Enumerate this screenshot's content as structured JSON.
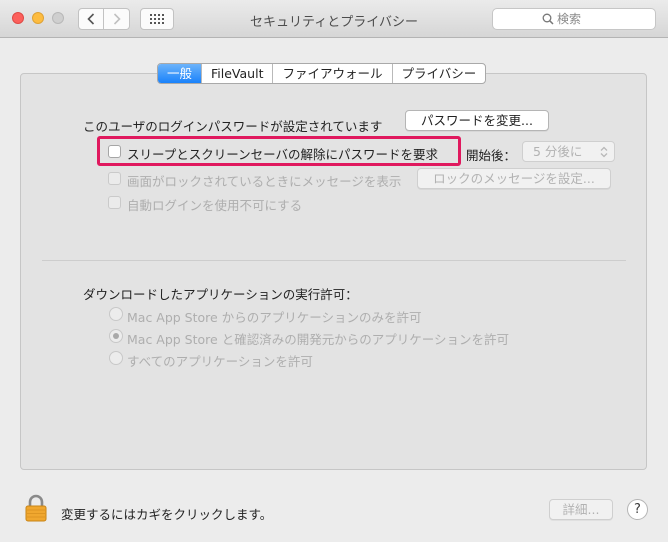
{
  "window": {
    "title": "セキュリティとプライバシー"
  },
  "search": {
    "placeholder": "検索"
  },
  "tabs": [
    {
      "label": "一般",
      "active": true
    },
    {
      "label": "FileVault",
      "active": false
    },
    {
      "label": "ファイアウォール",
      "active": false
    },
    {
      "label": "プライバシー",
      "active": false
    }
  ],
  "general": {
    "password_set_label": "このユーザのログインパスワードが設定されています",
    "change_password_button": "パスワードを変更...",
    "require_password_label": "スリープとスクリーンセーバの解除にパスワードを要求",
    "start_after_label": "開始後：",
    "start_after_value": "5 分後に",
    "show_message_label": "画面がロックされているときにメッセージを表示",
    "set_lock_message_button": "ロックのメッセージを設定...",
    "disable_auto_login_label": "自動ログインを使用不可にする"
  },
  "downloads": {
    "heading": "ダウンロードしたアプリケーションの実行許可：",
    "options": [
      {
        "label": "Mac App Store からのアプリケーションのみを許可",
        "selected": false
      },
      {
        "label": "Mac App Store と確認済みの開発元からのアプリケーションを許可",
        "selected": true
      },
      {
        "label": "すべてのアプリケーションを許可",
        "selected": false
      }
    ]
  },
  "footer": {
    "lock_text": "変更するにはカギをクリックします。",
    "advanced_button": "詳細...",
    "help_label": "?"
  },
  "colors": {
    "highlight": "#e0195e",
    "active_tab": "#1a82fb"
  }
}
